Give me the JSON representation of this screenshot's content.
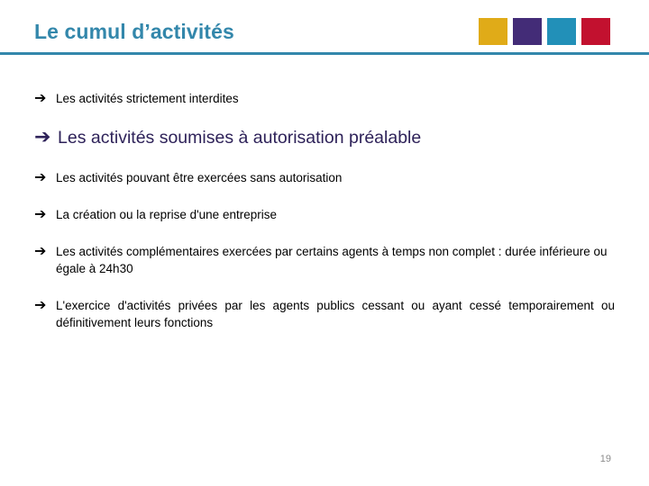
{
  "header": {
    "title": "Le cumul d’activités",
    "accent_line_color": "#3387ab",
    "title_color": "#3387ab",
    "squares": [
      {
        "name": "gold-square",
        "color": "#e0ab18"
      },
      {
        "name": "purple-square",
        "color": "#432c77"
      },
      {
        "name": "teal-square",
        "color": "#2290b8"
      },
      {
        "name": "red-square",
        "color": "#c2112f"
      }
    ]
  },
  "bullets": [
    {
      "icon": "arrow-right-icon",
      "glyph": "➔",
      "text": "Les activités strictement interdites",
      "emphasis": "normal",
      "justified": false
    },
    {
      "icon": "arrow-right-icon",
      "glyph": "➔",
      "text": "Les activités soumises à autorisation préalable",
      "emphasis": "big",
      "justified": false
    },
    {
      "icon": "arrow-right-icon",
      "glyph": "➔",
      "text": "Les activités pouvant être exercées sans autorisation",
      "emphasis": "normal",
      "justified": false
    },
    {
      "icon": "arrow-right-icon",
      "glyph": "➔",
      "text": "La création ou la reprise d'une entreprise",
      "emphasis": "normal",
      "justified": false
    },
    {
      "icon": "arrow-right-icon",
      "glyph": "➔",
      "text": "Les activités complémentaires exercées par certains agents à temps non complet : durée inférieure ou égale à 24h30",
      "emphasis": "normal",
      "justified": false
    },
    {
      "icon": "arrow-right-icon",
      "glyph": "➔",
      "text": "L'exercice d'activités privées par les agents publics cessant ou ayant cessé temporairement ou définitivement leurs fonctions",
      "emphasis": "normal",
      "justified": true
    }
  ],
  "footer": {
    "page_number": "19"
  }
}
